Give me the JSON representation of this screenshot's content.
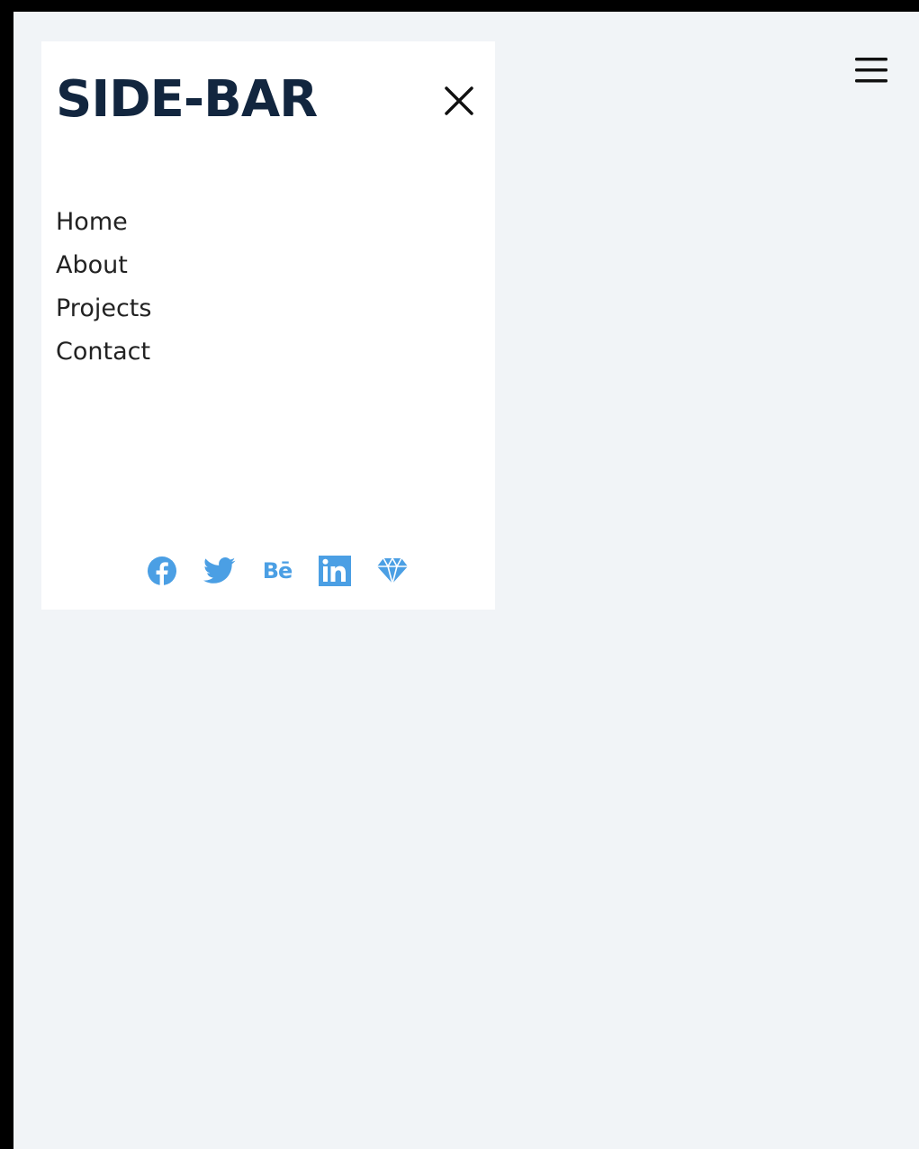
{
  "sidebar": {
    "title": "SIDE-BAR",
    "nav": [
      {
        "label": "Home"
      },
      {
        "label": "About"
      },
      {
        "label": "Projects"
      },
      {
        "label": "Contact"
      }
    ],
    "social": [
      {
        "name": "facebook-icon"
      },
      {
        "name": "twitter-icon"
      },
      {
        "name": "behance-icon",
        "text": "Bē"
      },
      {
        "name": "linkedin-icon"
      },
      {
        "name": "diamond-icon"
      }
    ]
  },
  "colors": {
    "page_bg": "#f1f4f7",
    "sidebar_bg": "#ffffff",
    "title": "#12263f",
    "social_accent": "#4b9fe4"
  }
}
